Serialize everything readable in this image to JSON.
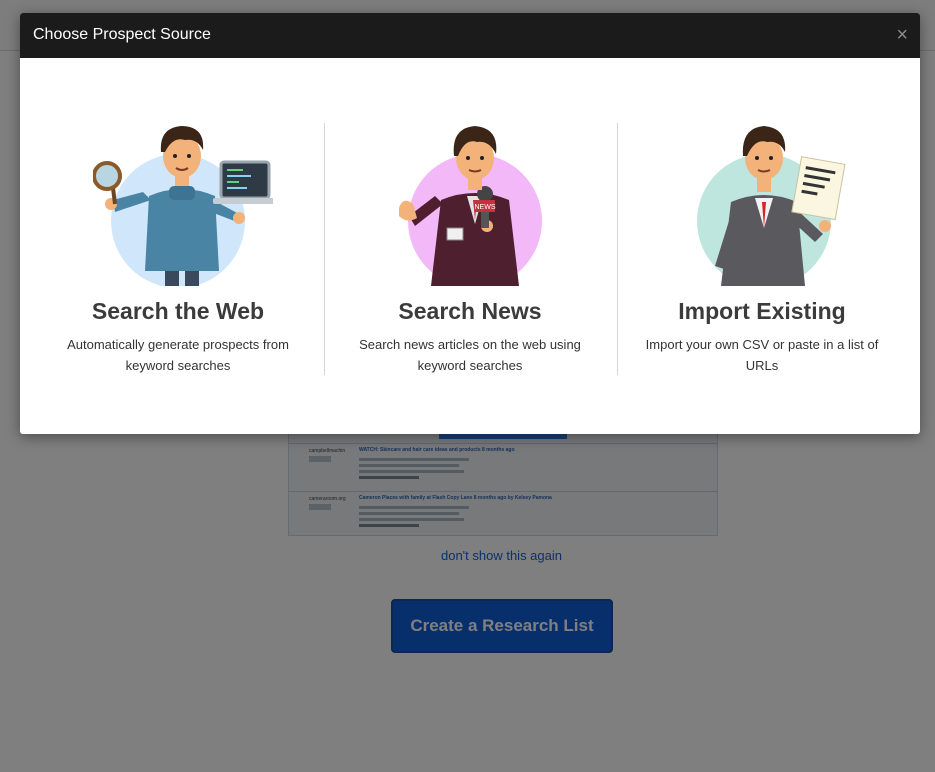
{
  "background": {
    "dont_show_link": "don't show this again",
    "create_button": "Create a Research List",
    "preview_rows": [
      {
        "site": "campbellmachin",
        "title": "WATCH: Skincare and hair care ideas and products 8 months ago"
      },
      {
        "site": "cameraroom.org",
        "title": "Cameron Places with family at Flash Copy Lane 8 months ago by Kelsey Pamona"
      }
    ]
  },
  "modal": {
    "title": "Choose Prospect Source",
    "close_label": "×",
    "options": [
      {
        "title": "Search the Web",
        "description": "Automatically generate prospects from keyword searches",
        "illustration": "person-with-magnifier-and-laptop",
        "circle_color": "#cfe6fb"
      },
      {
        "title": "Search News",
        "description": "Search news articles on the web using keyword searches",
        "illustration": "reporter-with-microphone",
        "circle_color": "#f2b8f7"
      },
      {
        "title": "Import Existing",
        "description": "Import your own CSV or paste in a list of URLs",
        "illustration": "businessman-with-document",
        "circle_color": "#bfe5df"
      }
    ]
  }
}
